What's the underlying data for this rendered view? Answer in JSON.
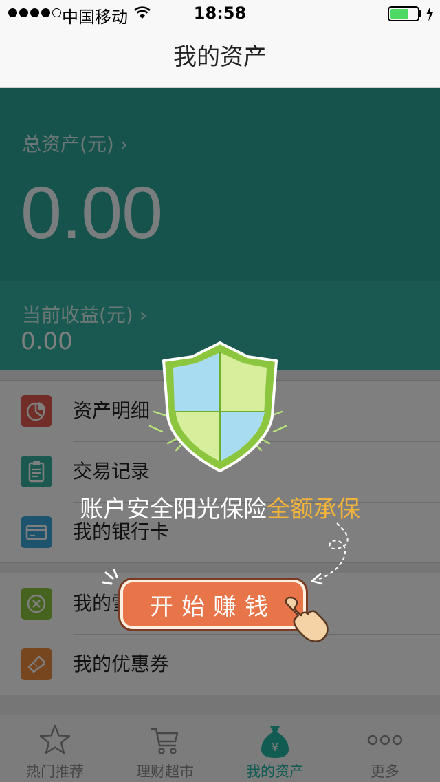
{
  "status_bar": {
    "carrier": "中国移动",
    "time": "18:58"
  },
  "nav": {
    "title": "我的资产"
  },
  "assets": {
    "total_label": "总资产(元) ›",
    "total_value": "0.00",
    "earnings_label": "当前收益(元) ›",
    "earnings_value": "0.00"
  },
  "list_group_1": [
    {
      "label": "资产明细",
      "icon": "pie-chart-icon",
      "color": "#e25a4e"
    },
    {
      "label": "交易记录",
      "icon": "clipboard-icon",
      "color": "#36b2a0"
    },
    {
      "label": "我的银行卡",
      "icon": "bank-card-icon",
      "color": "#3aa6d8"
    }
  ],
  "list_group_2": [
    {
      "label": "我的雪",
      "icon": "snow-icon",
      "color": "#8cc63f"
    },
    {
      "label": "我的优惠券",
      "icon": "coupon-icon",
      "color": "#ee8a3c"
    }
  ],
  "tabs": [
    {
      "label": "热门推荐",
      "icon": "star-icon",
      "active": false
    },
    {
      "label": "理财超市",
      "icon": "cart-icon",
      "active": false
    },
    {
      "label": "我的资产",
      "icon": "money-bag-icon",
      "active": true
    },
    {
      "label": "更多",
      "icon": "more-dots-icon",
      "active": false
    }
  ],
  "promo": {
    "text_main": "账户安全阳光保险",
    "text_highlight": "全额承保",
    "button_label": "开始赚钱"
  },
  "colors": {
    "accent": "#2ea79a",
    "active_tab": "#23b6a7",
    "highlight": "#f2b33d",
    "button": "#e8744a"
  }
}
